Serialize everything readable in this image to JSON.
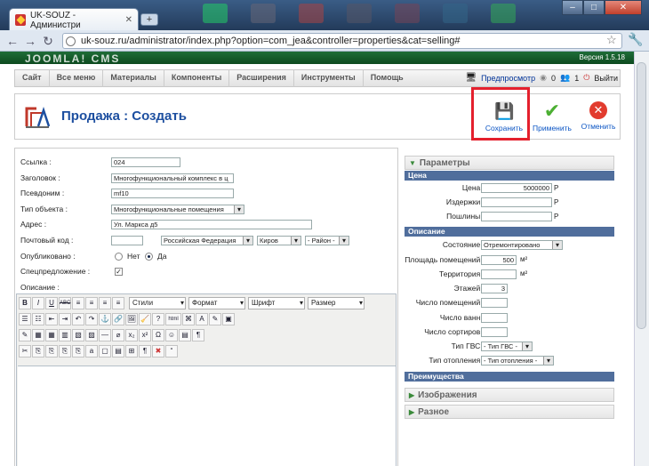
{
  "browser": {
    "tab_title": "UK-SOUZ - Администри",
    "tab_close": "✕",
    "new_tab": "+",
    "url": "uk-souz.ru/administrator/index.php?option=com_jea&controller=properties&cat=selling#"
  },
  "header": {
    "logo": "JOOMLA! CMS",
    "version": "Версия 1.5.18"
  },
  "menu": {
    "items": [
      "Сайт",
      "Все меню",
      "Материалы",
      "Компоненты",
      "Расширения",
      "Инструменты",
      "Помощь"
    ],
    "preview": "Предпросмотр",
    "messages": "0",
    "users": "1",
    "logout": "Выйти"
  },
  "title": {
    "text": "Продажа : Создать"
  },
  "toolbar": {
    "save": "Сохранить",
    "apply": "Применить",
    "cancel": "Отменить"
  },
  "form": {
    "link_label": "Ссылка :",
    "link_value": "024",
    "heading_label": "Заголовок :",
    "heading_value": "Многофункциональный комплекс в ц",
    "alias_label": "Псевдоним :",
    "alias_value": "mf10",
    "type_label": "Тип объекта :",
    "type_value": "Многофункциональные помещения",
    "address_label": "Адрес :",
    "address_value": "Ул. Маркса д5",
    "zip_label": "Почтовый код :",
    "country_value": "Российская Федерация",
    "city_value": "Киров",
    "district_value": "- Район -",
    "published_label": "Опубликовано :",
    "no_label": "Нет",
    "yes_label": "Да",
    "special_label": "Спецпредложение :",
    "special_check": "✓",
    "desc_label": "Описание :"
  },
  "editor": {
    "styles": "Стили",
    "format": "Формат",
    "font": "Шрифт",
    "size": "Размер",
    "row1": [
      "B",
      "I",
      "U",
      "ABC",
      "≡",
      "≡",
      "≡",
      "≡"
    ],
    "row2": [
      "✂",
      "⎘",
      "⎗",
      "↶",
      "↷",
      "⚓",
      "🔗",
      "?",
      "html",
      "⌘",
      "A",
      "✎"
    ],
    "row3": [
      "✎",
      "▦",
      "▦",
      "—",
      "x₂",
      "x²",
      "Ω",
      "☺",
      "▤"
    ],
    "row4": [
      "✂",
      "⎘",
      "⎘",
      "⎘",
      "⎘",
      "a",
      "▢",
      "¶",
      "“"
    ]
  },
  "params": {
    "title": "Параметры",
    "price_section": "Цена",
    "price_label": "Цена :",
    "price_value": "5000000",
    "price_unit": "Р",
    "expenses_label": "Издержки :",
    "expenses_unit": "Р",
    "fees_label": "Пошлины :",
    "fees_unit": "Р",
    "desc_section": "Описание",
    "state_label": "Состояние :",
    "state_value": "Отремонтировано",
    "area_label": "Площадь помещений :",
    "area_value": "500",
    "area_unit": "м²",
    "land_label": "Территория :",
    "land_unit": "м²",
    "floors_label": "Этажей :",
    "floors_value": "3",
    "rooms_label": "Число помещений :",
    "baths_label": "Число ванн :",
    "toilets_label": "Число сортиров :",
    "hw_label": "Тип ГВС :",
    "hw_value": "- Тип ГВС -",
    "heat_label": "Тип отопления :",
    "heat_value": "- Тип отопления -",
    "adv_section": "Преимущества",
    "images": "Изображения",
    "misc": "Разное"
  }
}
